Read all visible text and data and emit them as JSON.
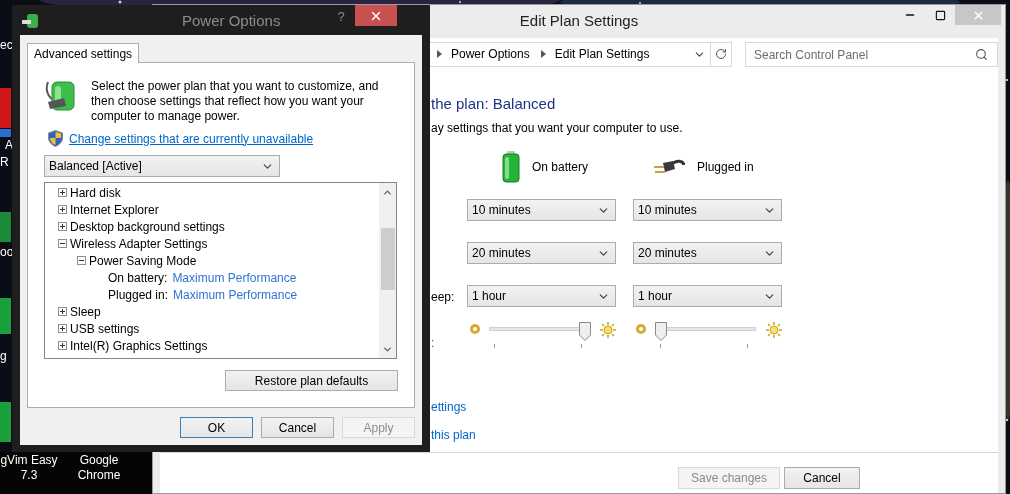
{
  "desktop": {
    "fragments": [
      "ec",
      "A",
      "R",
      "oo",
      "g"
    ],
    "shortcuts": [
      {
        "line1": "gVim Easy",
        "line2": "7.3"
      },
      {
        "line1": "Google",
        "line2": "Chrome"
      }
    ]
  },
  "edit_plan": {
    "title": "Edit Plan Settings",
    "breadcrumbs": [
      "Power Options",
      "Edit Plan Settings"
    ],
    "search": {
      "placeholder": "Search Control Panel"
    },
    "heading": "the plan: Balanced",
    "subheading": "ay settings that you want your computer to use.",
    "columns": [
      {
        "kind": "battery",
        "label": "On battery"
      },
      {
        "kind": "plugged",
        "label": "Plugged in"
      }
    ],
    "rows": [
      {
        "values": [
          "10 minutes",
          "10 minutes"
        ]
      },
      {
        "values": [
          "20 minutes",
          "20 minutes"
        ]
      },
      {
        "label": "eep:",
        "values": [
          "1 hour",
          "1 hour"
        ]
      }
    ],
    "brightness": {
      "label": ":",
      "sliders": [
        {
          "level": 1
        },
        {
          "level": 0
        }
      ]
    },
    "links": [
      "ettings",
      "this plan"
    ],
    "buttons": [
      {
        "label": "Save changes",
        "disabled": true
      },
      {
        "label": "Cancel",
        "disabled": false
      }
    ]
  },
  "dialog": {
    "title": "Power Options",
    "help": "?",
    "tab": {
      "label": "Advanced settings",
      "selected": true
    },
    "description": "Select the power plan that you want to customize, and then choose settings that reflect how you want your computer to manage power.",
    "link": "Change settings that are currently unavailable",
    "plan": {
      "value": "Balanced [Active]"
    },
    "tree": [
      {
        "label": "Hard disk",
        "expanded": false
      },
      {
        "label": "Internet Explorer",
        "expanded": false
      },
      {
        "label": "Desktop background settings",
        "expanded": false
      },
      {
        "label": "Wireless Adapter Settings",
        "expanded": true,
        "children": [
          {
            "label": "Power Saving Mode",
            "expanded": true,
            "children": [
              {
                "label": "On battery:",
                "value": "Maximum Performance"
              },
              {
                "label": "Plugged in:",
                "value": "Maximum Performance"
              }
            ]
          }
        ]
      },
      {
        "label": "Sleep",
        "expanded": false
      },
      {
        "label": "USB settings",
        "expanded": false
      },
      {
        "label": "Intel(R) Graphics Settings",
        "expanded": false
      }
    ],
    "restore_button": "Restore plan defaults",
    "buttons": [
      {
        "label": "OK",
        "focused": true,
        "disabled": false
      },
      {
        "label": "Cancel",
        "focused": false,
        "disabled": false
      },
      {
        "label": "Apply",
        "focused": false,
        "disabled": true
      }
    ]
  }
}
